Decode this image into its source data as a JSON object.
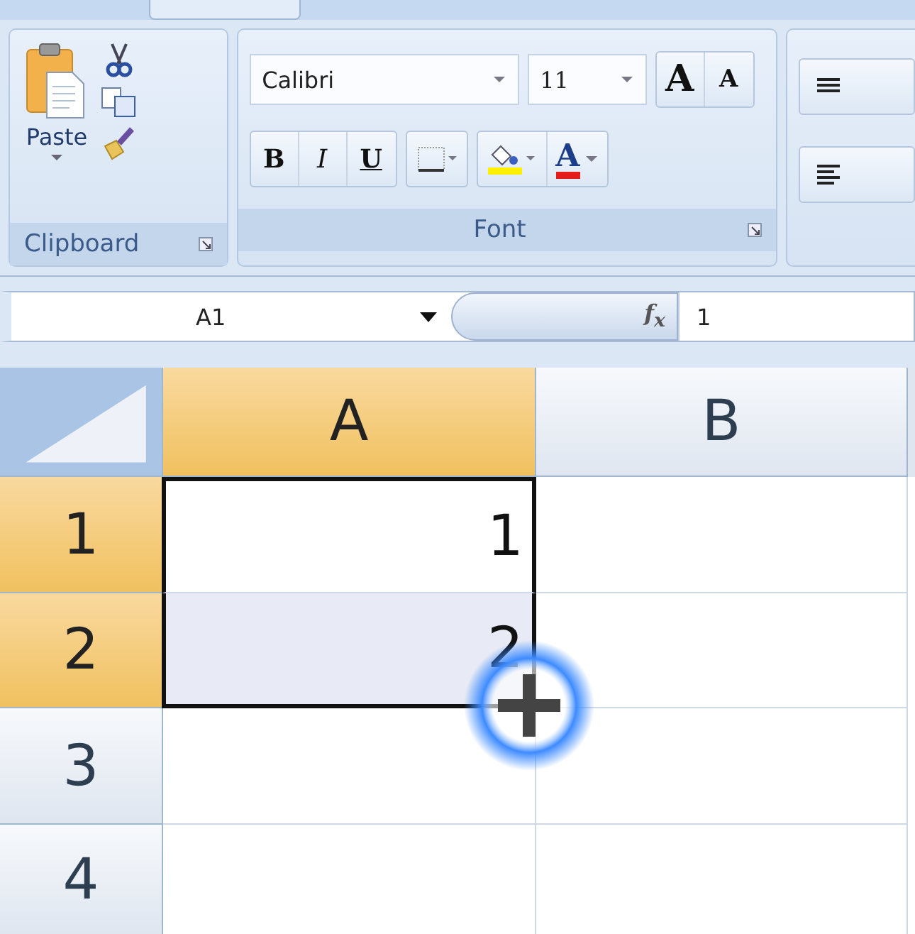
{
  "ribbon": {
    "groups": [
      {
        "kind": "clipboard",
        "label": "Clipboard",
        "paste_label": "Paste"
      },
      {
        "kind": "font",
        "label": "Font",
        "font_name": "Calibri",
        "font_size": "11",
        "grow": "A",
        "shrink": "A",
        "bold": "B",
        "italic": "I",
        "underline": "U",
        "font_color": "A"
      },
      {
        "kind": "alignment"
      }
    ]
  },
  "formula_bar": {
    "name_box": "A1",
    "fx": "f$_{x}$",
    "value": "1"
  },
  "sheet": {
    "columns": [
      {
        "label": "A",
        "selected": true
      },
      {
        "label": "B",
        "selected": false
      }
    ],
    "rows": [
      {
        "label": "1",
        "selected": true,
        "active": true,
        "value": "1"
      },
      {
        "label": "2",
        "selected": true,
        "active": false,
        "value": "2"
      },
      {
        "label": "3",
        "selected": false
      },
      {
        "label": "4",
        "selected": false
      }
    ],
    "fill_cursor": true
  }
}
